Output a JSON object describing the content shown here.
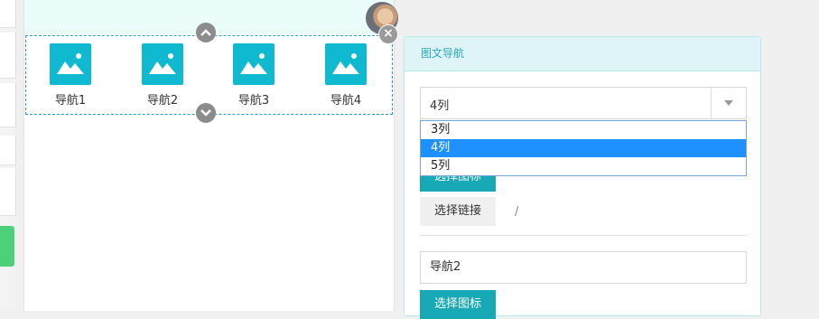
{
  "preview": {
    "nav_items": [
      {
        "label": "导航1"
      },
      {
        "label": "导航2"
      },
      {
        "label": "导航3"
      },
      {
        "label": "导航4"
      }
    ]
  },
  "panel": {
    "title": "图文导航",
    "column_select": {
      "selected": "4列",
      "options": [
        "3列",
        "4列",
        "5列"
      ]
    },
    "select_icon_label": "选择图标",
    "select_link_label": "选择链接",
    "link_separator": "/",
    "nav_name_value": "导航2",
    "select_icon_label_2": "选择图标"
  },
  "colors": {
    "accent_teal": "#17a9b5",
    "image_placeholder": "#0fbad0",
    "dropdown_selected": "#1e90ff",
    "panel_header_bg": "#dff4f7",
    "green_button": "#4cd17a"
  }
}
